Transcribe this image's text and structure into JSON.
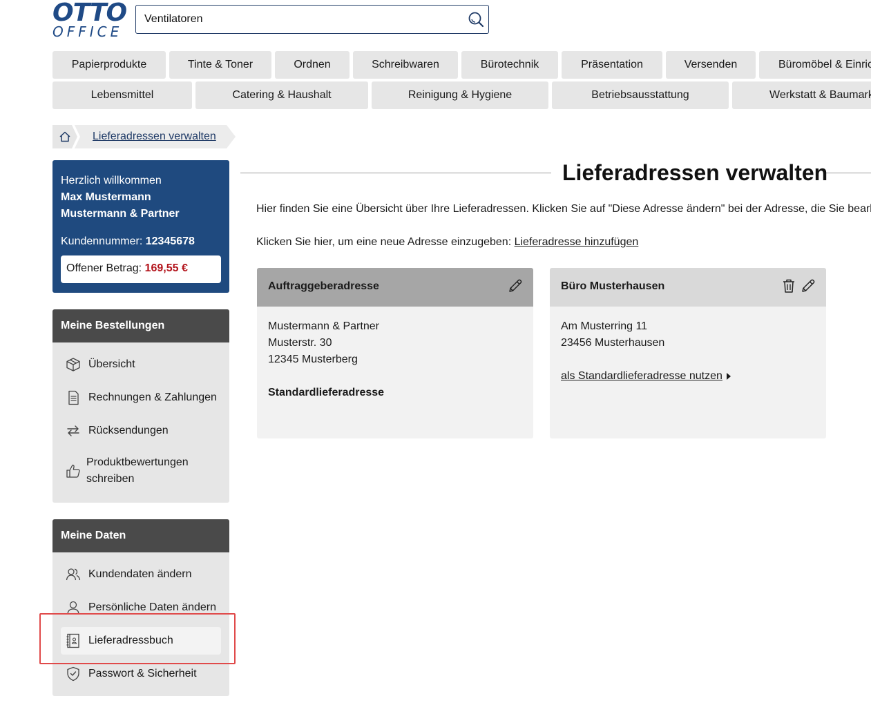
{
  "brand": {
    "logo_top": "OTTO",
    "logo_bottom": "OFFICE",
    "color": "#1f4a86"
  },
  "search": {
    "value": "Ventilatoren",
    "icon": "search-icon"
  },
  "nav": {
    "row1": [
      "Papierprodukte",
      "Tinte & Toner",
      "Ordnen",
      "Schreibwaren",
      "Bürotechnik",
      "Präsentation",
      "Versenden",
      "Büromöbel & Einric"
    ],
    "row2": [
      "Lebensmittel",
      "Catering & Haushalt",
      "Reinigung & Hygiene",
      "Betriebsausstattung",
      "Werkstatt & Baumarkt"
    ]
  },
  "breadcrumb": {
    "home_icon": "home-icon",
    "current": "Lieferadressen verwalten"
  },
  "welcome": {
    "greeting": "Herzlich willkommen",
    "name": "Max Mustermann",
    "company": "Mustermann & Partner",
    "customer_label": "Kundennummer:",
    "customer_number": "12345678",
    "open_label": "Offener Betrag:",
    "open_amount": "169,55 €"
  },
  "orders": {
    "title": "Meine Bestellungen",
    "items": [
      {
        "label": "Übersicht",
        "icon": "box-icon"
      },
      {
        "label": "Rechnungen & Zahlungen",
        "icon": "invoice-icon"
      },
      {
        "label": "Rücksendungen",
        "icon": "return-icon"
      },
      {
        "label_line1": "Produktbewertungen",
        "label_line2": "schreiben",
        "icon": "thumbs-up-icon"
      }
    ]
  },
  "mydata": {
    "title": "Meine Daten",
    "items": [
      {
        "label": "Kundendaten ändern",
        "icon": "users-icon"
      },
      {
        "label": "Persönliche Daten ändern",
        "icon": "user-icon"
      },
      {
        "label": "Lieferadressbuch",
        "icon": "address-book-icon",
        "active": true
      },
      {
        "label": "Passwort & Sicherheit",
        "icon": "shield-icon"
      }
    ]
  },
  "main": {
    "title": "Lieferadressen verwalten",
    "intro": "Hier finden Sie eine Übersicht über Ihre Lieferadressen. Klicken Sie auf \"Diese Adresse ändern\" bei der Adresse, die Sie bearbei",
    "add_prefix": "Klicken Sie hier, um eine neue Adresse einzugeben:",
    "add_link": "Lieferadresse hinzufügen"
  },
  "cards": [
    {
      "title": "Auftraggeberadresse",
      "lines": [
        "Mustermann & Partner",
        "Musterstr. 30",
        "12345 Musterberg"
      ],
      "status": "Standardlieferadresse",
      "header_color": "#a6a6a6"
    },
    {
      "title": "Büro Musterhausen",
      "lines": [
        "Am Musterring 11",
        "23456 Musterhausen"
      ],
      "link": "als Standardlieferadresse nutzen",
      "header_color": "#d9d9d9"
    }
  ]
}
